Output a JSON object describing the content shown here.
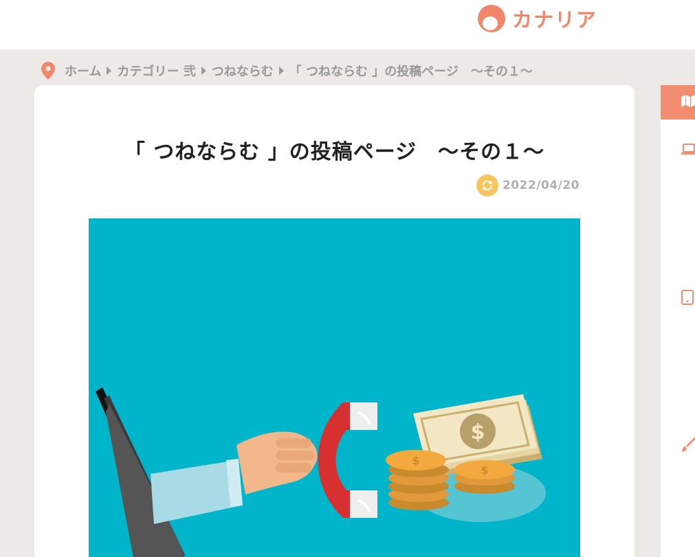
{
  "header": {
    "logo_text": "カナリア",
    "brand_color": "#f0876a"
  },
  "breadcrumb": {
    "icon": "location-pin-icon",
    "items": [
      "ホーム",
      "カテゴリー 弐",
      "つねならむ",
      "「 つねならむ 」の投稿ページ　～その１～"
    ]
  },
  "article": {
    "title": "「 つねならむ 」の投稿ページ　～その１～",
    "updated_date": "2022/04/20",
    "update_icon": "refresh-icon",
    "hero_background": "#00b5c9"
  },
  "sidebar": {
    "tab_icon": "map-icon",
    "tab_color": "#f28d70",
    "icons": [
      "laptop-icon",
      "tablet-icon",
      "brush-icon"
    ]
  }
}
